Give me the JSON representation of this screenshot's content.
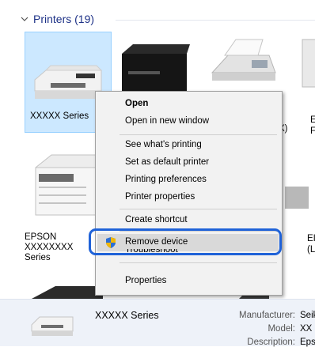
{
  "group": {
    "title": "Printers (19)"
  },
  "printers": [
    {
      "label": "XXXXX Series"
    },
    {
      "label": "EPSON\nXXXXXXXX\nSeries"
    }
  ],
  "clipped_labels": {
    "mid_right_suffix": "X)",
    "far_right_e": "E",
    "far_right_f": "F",
    "left_ep": "EI",
    "left_paren": "(L"
  },
  "context_menu": {
    "open": "Open",
    "open_new_window": "Open in new window",
    "see_printing": "See what's printing",
    "set_default": "Set as default printer",
    "printing_prefs": "Printing preferences",
    "printer_props": "Printer properties",
    "create_shortcut": "Create shortcut",
    "remove_device": "Remove device",
    "troubleshoot": "Troubleshoot",
    "properties": "Properties"
  },
  "details": {
    "name": "XXXXX Series",
    "manufacturer_label": "Manufacturer:",
    "manufacturer_value": "Seik",
    "model_label": "Model:",
    "model_value": "XX",
    "description_label": "Description:",
    "description_value": "Eps"
  },
  "colors": {
    "selection": "#cce8ff",
    "ring": "#1f62d8",
    "header_text": "#1e3287"
  },
  "icons": {
    "chevron": "chevron-down-icon",
    "shield": "uac-shield-icon"
  }
}
